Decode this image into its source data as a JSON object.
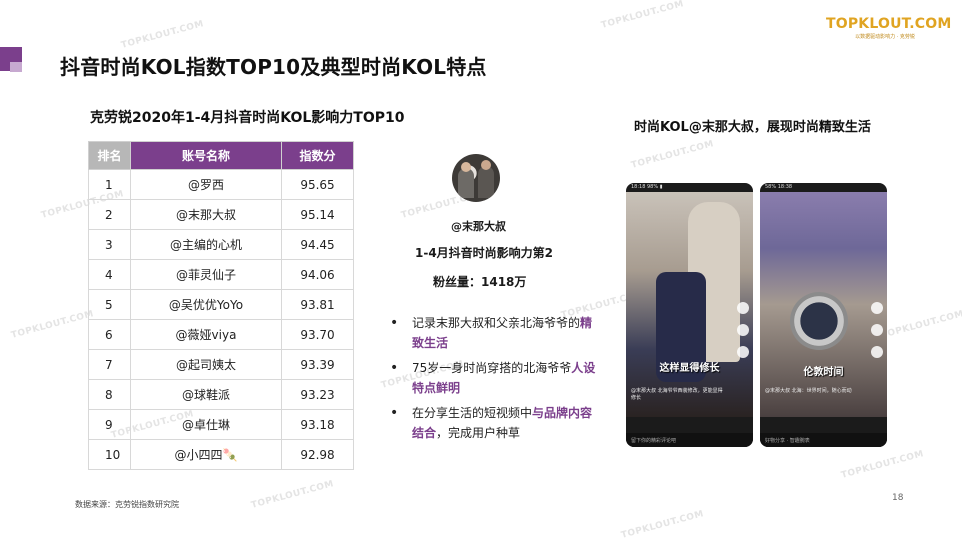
{
  "page": {
    "title": "抖音时尚KOL指数TOP10及典型时尚KOL特点",
    "page_number": "18",
    "source": "数据来源：克劳锐指数研究院"
  },
  "logo": {
    "main": "TOPKLOUT.COM",
    "sub": "以数据驱动影响力 · 克劳锐"
  },
  "watermark": "TOPKLOUT.COM",
  "table": {
    "title": "克劳锐2020年1-4月抖音时尚KOL影响力TOP10",
    "headers": [
      "排名",
      "账号名称",
      "指数分"
    ],
    "rows": [
      {
        "rank": "1",
        "name": "@罗西",
        "score": "95.65"
      },
      {
        "rank": "2",
        "name": "@末那大叔",
        "score": "95.14"
      },
      {
        "rank": "3",
        "name": "@主编的心机",
        "score": "94.45"
      },
      {
        "rank": "4",
        "name": "@菲灵仙子",
        "score": "94.06"
      },
      {
        "rank": "5",
        "name": "@吴优优YoYo",
        "score": "93.81"
      },
      {
        "rank": "6",
        "name": "@薇娅viya",
        "score": "93.70"
      },
      {
        "rank": "7",
        "name": "@起司姨太",
        "score": "93.39"
      },
      {
        "rank": "8",
        "name": "@球鞋派",
        "score": "93.23"
      },
      {
        "rank": "9",
        "name": "@卓仕琳",
        "score": "93.18"
      },
      {
        "rank": "10",
        "name": "@小四四🍡",
        "score": "92.98"
      }
    ]
  },
  "profile": {
    "name": "@末那大叔",
    "rank_text": "1-4月抖音时尚影响力第2",
    "fans_text": "粉丝量：1418万"
  },
  "points": [
    {
      "pre": "记录末那大叔和父亲北海爷爷的",
      "hl": "精致生活",
      "post": ""
    },
    {
      "pre": "75岁一身时尚穿搭的北海爷爷",
      "hl": "人设特点鲜明",
      "post": ""
    },
    {
      "pre": "在分享生活的短视频中",
      "hl": "与品牌内容结合",
      "post": "，完成用户种草"
    }
  ],
  "right": {
    "title": "时尚KOL@末那大叔，展现时尚精致生活",
    "phone1": {
      "status": "18:18  98% ▮",
      "caption": "这样显得修长",
      "meta": "@末那大叔\n北海爷爷西装修改，更能显得修长",
      "bottom": "留下你的精彩评论吧"
    },
    "phone2": {
      "status": "58% 18:38",
      "caption": "伦敦时间",
      "meta": "@末那大叔\n北海：世界时间，随心而动",
      "bottom": "好物分享 · 智趣腕表"
    }
  }
}
